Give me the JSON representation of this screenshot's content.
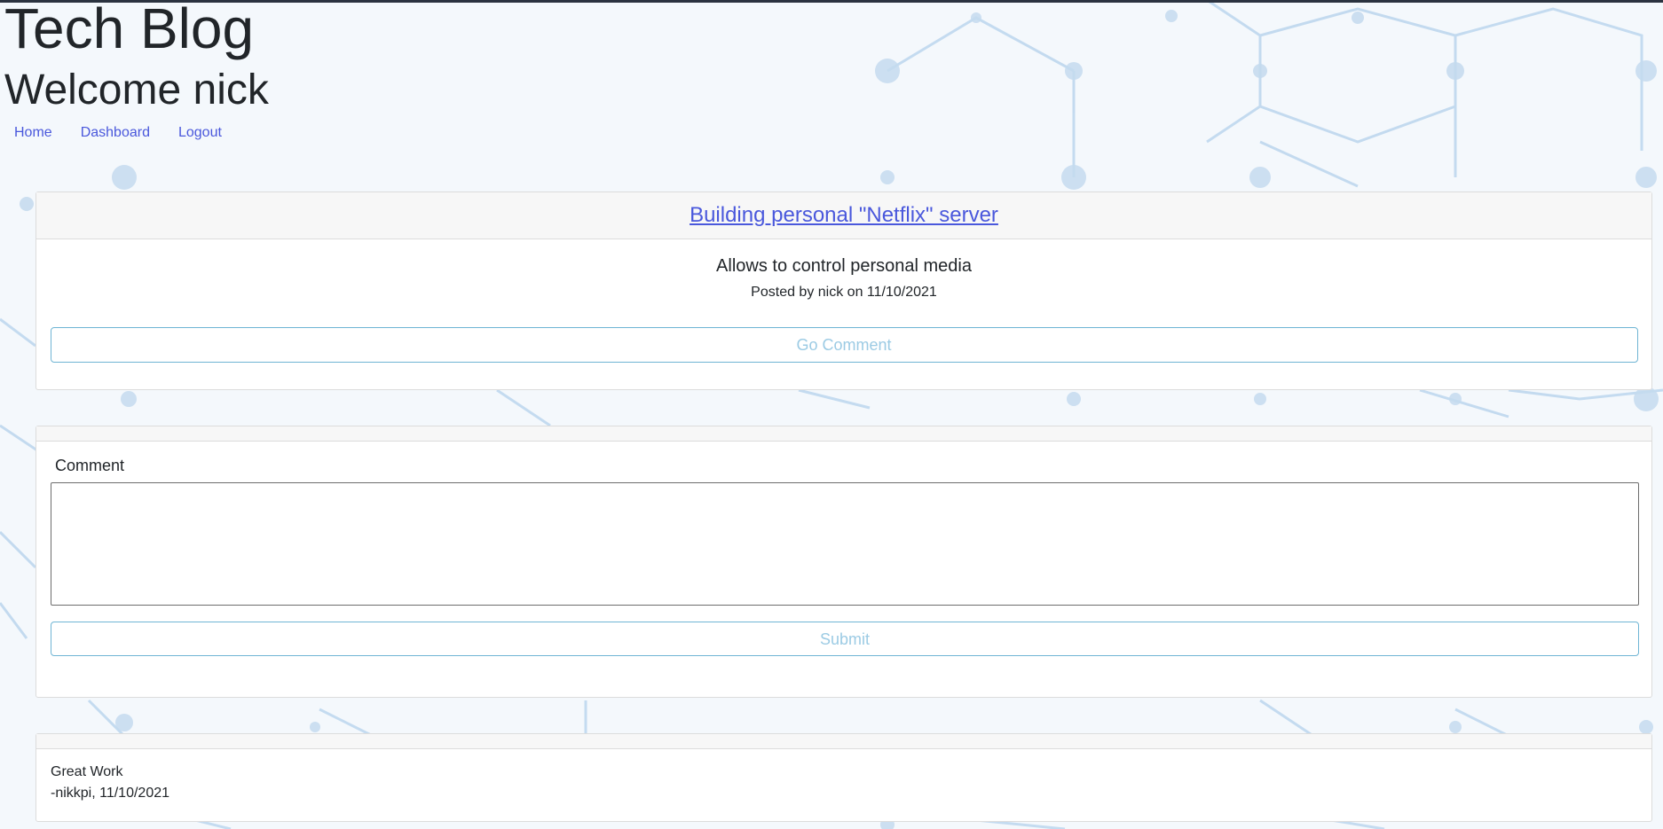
{
  "header": {
    "title": "Tech Blog",
    "welcome": "Welcome nick"
  },
  "nav": {
    "home": "Home",
    "dashboard": "Dashboard",
    "logout": "Logout"
  },
  "post": {
    "title": "Building personal \"Netflix\" server",
    "description": "Allows to control personal media",
    "meta": "Posted by nick on 11/10/2021",
    "comment_button": "Go Comment"
  },
  "comment_form": {
    "label": "Comment",
    "value": "",
    "submit": "Submit"
  },
  "comments": [
    {
      "text": "Great Work",
      "meta": "-nikkpi, 11/10/2021"
    }
  ],
  "colors": {
    "link": "#4a58dc",
    "button_border": "#6fb5d4",
    "button_text": "#9ccbe4",
    "card_header": "#f7f7f7"
  }
}
